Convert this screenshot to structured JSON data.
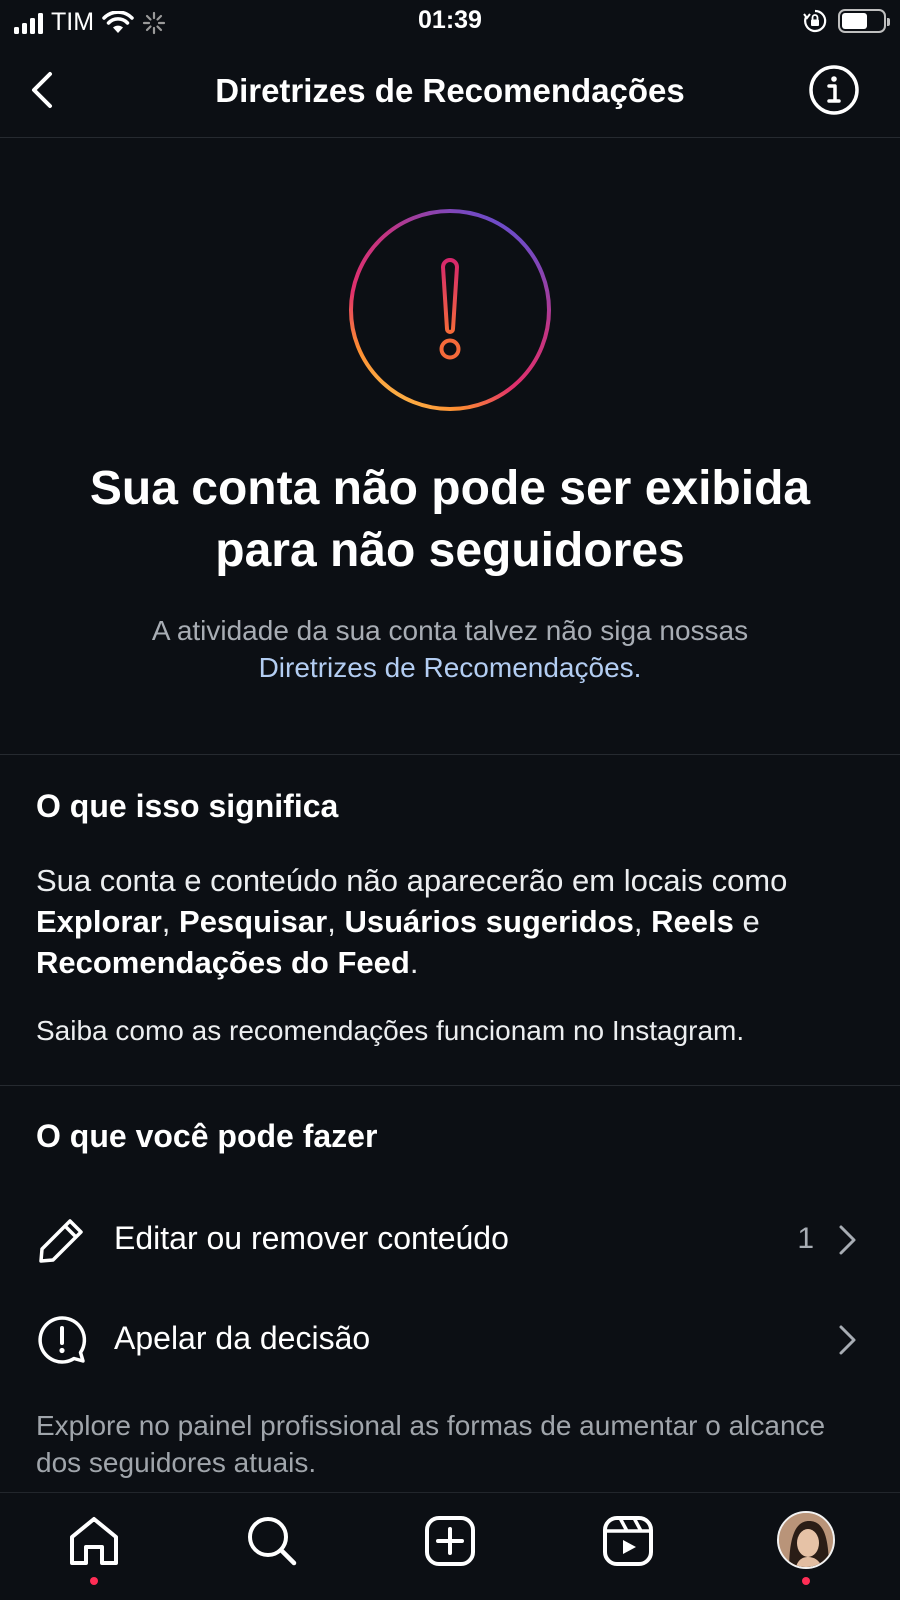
{
  "status_bar": {
    "carrier": "TIM",
    "time": "01:39"
  },
  "header": {
    "title": "Diretrizes de Recomendações"
  },
  "hero": {
    "title": "Sua conta não pode ser exibida para não seguidores",
    "subtitle_prefix": "A atividade da sua conta talvez não siga nossas",
    "subtitle_link": "Diretrizes de Recomendações",
    "subtitle_suffix": "."
  },
  "meaning": {
    "title": "O que isso significa",
    "text_1": "Sua conta e conteúdo não aparecerão em locais como ",
    "explorar": "Explorar",
    "sep_1": ", ",
    "pesquisar": "Pesquisar",
    "sep_2": ", ",
    "usuarios": "Usuários sugeridos",
    "sep_3": ", ",
    "reels": "Reels",
    "conj": " e ",
    "feed": "Recomendações do Feed",
    "end": ".",
    "learn_more": "Saiba como as recomendações funcionam no Instagram."
  },
  "actions": {
    "title": "O que você pode fazer",
    "items": [
      {
        "label": "Editar ou remover conteúdo",
        "count": "1",
        "icon": "pencil-icon"
      },
      {
        "label": "Apelar da decisão",
        "count": "",
        "icon": "alert-bubble-icon"
      }
    ],
    "footer_note": "Explore no painel profissional as formas de aumentar o alcance dos seguidores atuais."
  },
  "tab_bar": {
    "items": [
      "home-icon",
      "search-icon",
      "create-icon",
      "reels-icon",
      "profile-avatar"
    ]
  },
  "colors": {
    "background": "#0c0f14",
    "link": "#b3cdf2",
    "muted": "#a8adb4",
    "notification_dot": "#ff2d55"
  }
}
